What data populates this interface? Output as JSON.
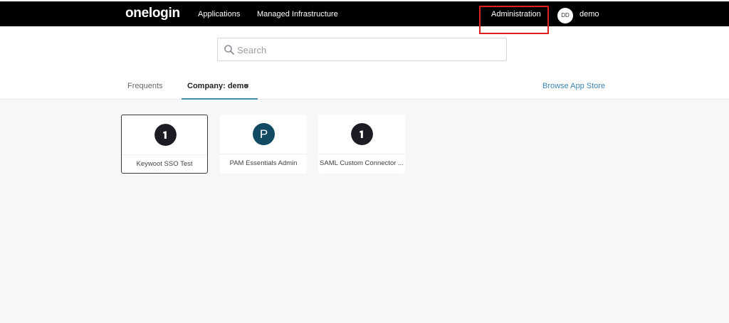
{
  "topbar": {
    "logo": "onelogin",
    "nav": [
      "Applications",
      "Managed Infrastructure"
    ],
    "admin_label": "Administration",
    "user_initials": "DD",
    "user_name": "demo"
  },
  "search": {
    "placeholder": "Search"
  },
  "tabs": {
    "frequents": "Frequents",
    "company": "Company: demo",
    "browse": "Browse App Store"
  },
  "apps": [
    {
      "label": "Keywoot SSO Test",
      "icon": "onelogin-icon",
      "icon_color": "#1c1d24",
      "selected": true
    },
    {
      "label": "PAM Essentials Admin",
      "icon": "p-letter-icon",
      "icon_letter": "P",
      "icon_color": "#124a63",
      "selected": false
    },
    {
      "label": "SAML Custom Connector ...",
      "icon": "onelogin-icon",
      "icon_color": "#1c1d24",
      "selected": false
    }
  ],
  "colors": {
    "topbar": "#000000",
    "accent_link": "#3d85b5",
    "highlight_box": "#e02020"
  }
}
